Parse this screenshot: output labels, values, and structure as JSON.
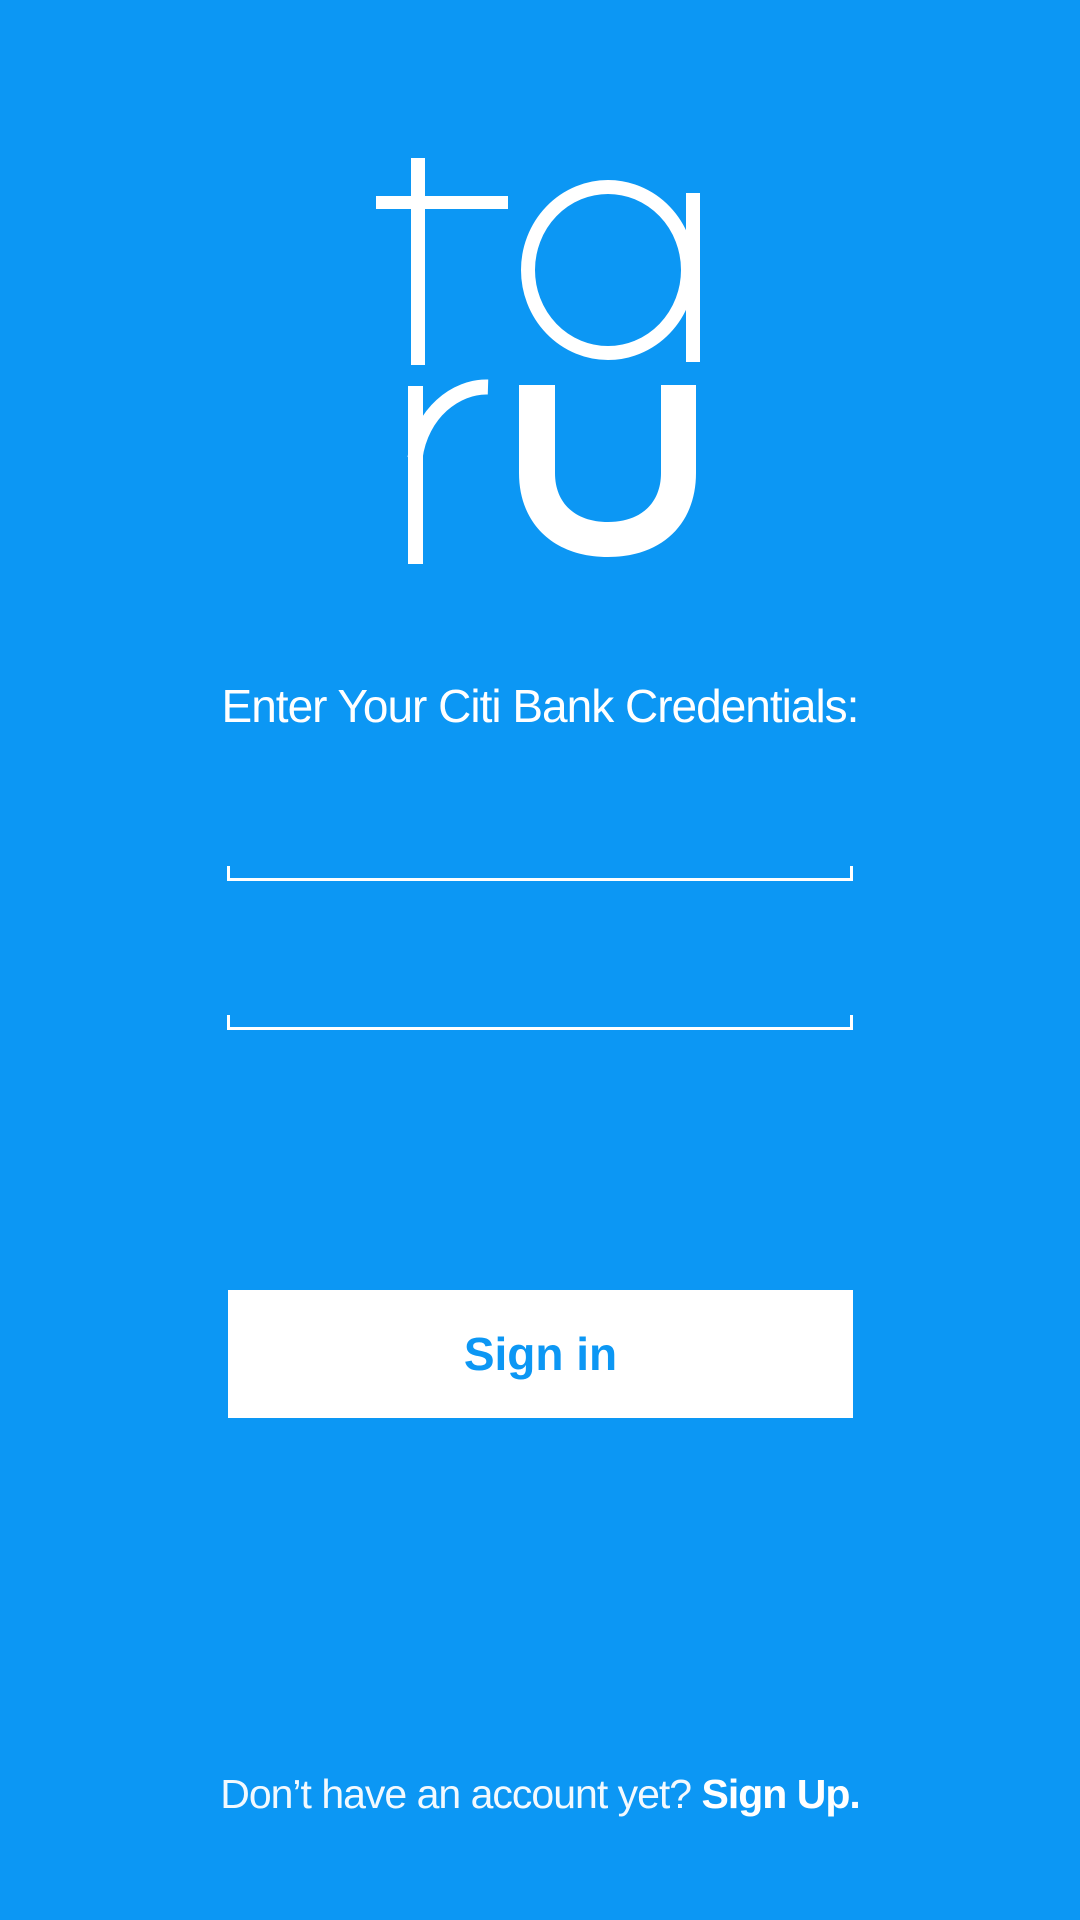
{
  "colors": {
    "background": "#0c97f4",
    "foreground": "#ffffff",
    "button_text": "#0c97f4"
  },
  "logo": {
    "letters": "taru"
  },
  "login": {
    "prompt": "Enter Your Citi Bank Credentials:",
    "username_value": "",
    "password_value": "",
    "sign_in_label": "Sign in"
  },
  "footer": {
    "lead_text": "Don’t have an account yet?",
    "sign_up_label": "Sign Up."
  }
}
